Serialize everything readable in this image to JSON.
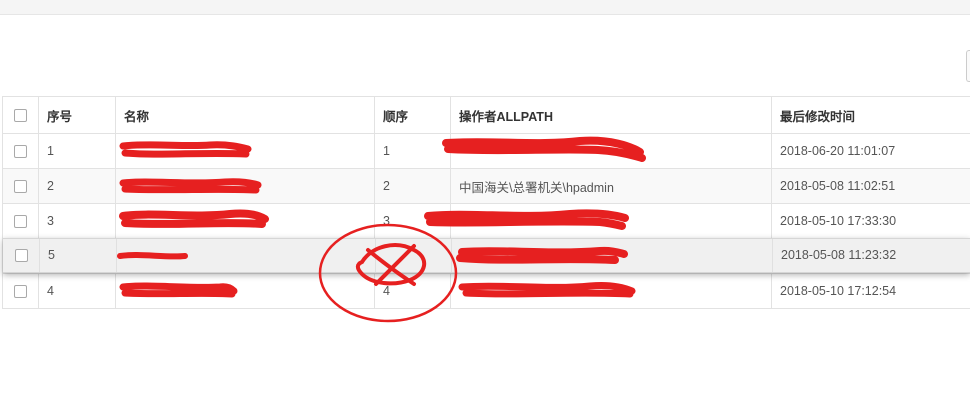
{
  "columns": {
    "seq": "序号",
    "name": "名称",
    "order": "顺序",
    "operator": "操作者ALLPATH",
    "modified": "最后修改时间"
  },
  "rows": [
    {
      "seq": "1",
      "name": "",
      "order": "1",
      "operator": "",
      "modified": "2018-06-20 11:01:07"
    },
    {
      "seq": "2",
      "name": "",
      "order": "2",
      "operator": "中国海关\\总署机关\\hpadmin",
      "modified": "2018-05-08 11:02:51"
    },
    {
      "seq": "3",
      "name": "",
      "order": "3",
      "operator": "",
      "modified": "2018-05-10 17:33:30"
    },
    {
      "seq": "4",
      "name": "",
      "order": "4",
      "operator": "",
      "modified": "2018-05-10 17:12:54"
    }
  ],
  "dragging_row": {
    "seq": "5",
    "name": "",
    "order": "",
    "operator": "",
    "modified": "2018-05-08 11:23:32"
  },
  "colors": {
    "annotation": "#e62020",
    "header_text": "#333333",
    "body_text": "#555555",
    "border": "#e2e2e2"
  }
}
